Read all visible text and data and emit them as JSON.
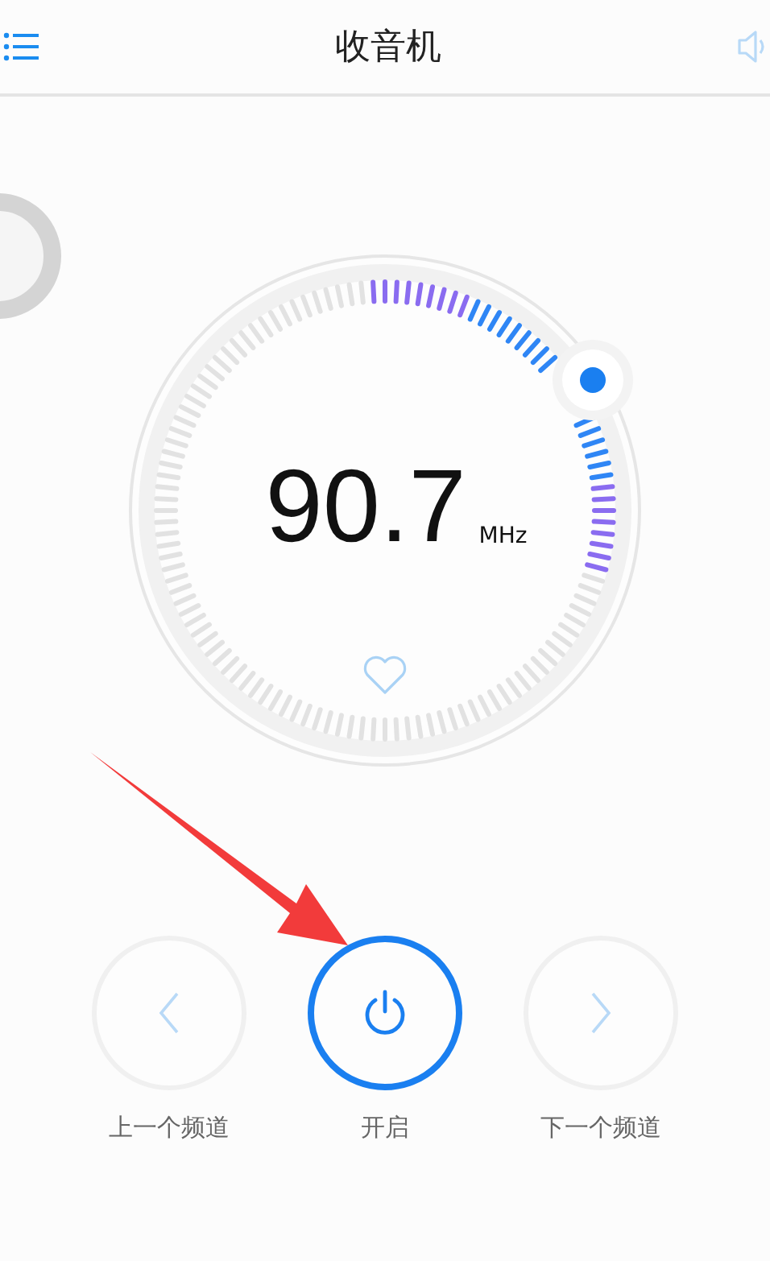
{
  "header": {
    "title": "收音机"
  },
  "tuner": {
    "frequency": "90.7",
    "unit": "MHz",
    "favorite": false
  },
  "controls": [
    {
      "kind": "prev",
      "label": "上一个频道",
      "active": false
    },
    {
      "kind": "power",
      "label": "开启",
      "active": true
    },
    {
      "kind": "next",
      "label": "下一个频道",
      "active": false
    }
  ]
}
